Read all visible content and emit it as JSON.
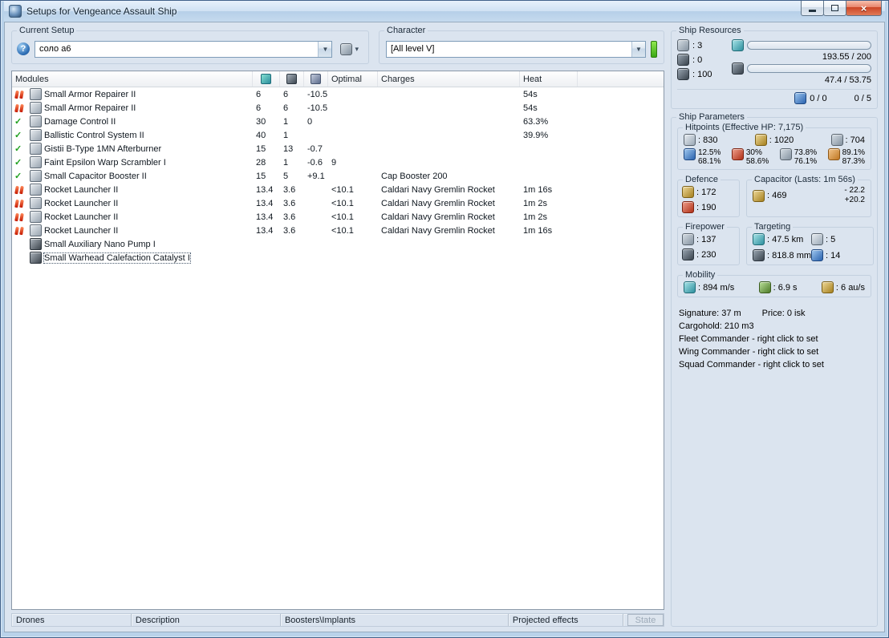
{
  "window": {
    "title": "Setups for Vengeance Assault Ship"
  },
  "setup": {
    "label": "Current Setup",
    "value": "соло а6"
  },
  "character": {
    "label": "Character",
    "value": "[All level V]"
  },
  "resources": {
    "label": "Ship Resources",
    "turrets": ": 3",
    "launchers": ": 0",
    "calibration": ": 100",
    "cpu": {
      "text": "193.55 / 200",
      "pct": 97
    },
    "powergrid": {
      "text": "47.4 / 53.75",
      "pct": 88
    },
    "drones": "0 / 0",
    "rigs": "0 / 5"
  },
  "modules": {
    "headers": {
      "name": "Modules",
      "optimal": "Optimal",
      "charges": "Charges",
      "heat": "Heat"
    },
    "rows": [
      {
        "state": "overload",
        "name": "Small Armor Repairer II",
        "cpu": "6",
        "pg": "6",
        "cap": "-10.5",
        "opt": "",
        "chg": "",
        "heat": "54s"
      },
      {
        "state": "overload",
        "name": "Small Armor Repairer II",
        "cpu": "6",
        "pg": "6",
        "cap": "-10.5",
        "opt": "",
        "chg": "",
        "heat": "54s"
      },
      {
        "state": "active",
        "name": "Damage Control II",
        "cpu": "30",
        "pg": "1",
        "cap": "0",
        "opt": "",
        "chg": "",
        "heat": "63.3%"
      },
      {
        "state": "active",
        "name": "Ballistic Control System II",
        "cpu": "40",
        "pg": "1",
        "cap": "",
        "opt": "",
        "chg": "",
        "heat": "39.9%"
      },
      {
        "state": "active",
        "name": "Gistii B-Type 1MN Afterburner",
        "cpu": "15",
        "pg": "13",
        "cap": "-0.7",
        "opt": "",
        "chg": "",
        "heat": ""
      },
      {
        "state": "active",
        "name": "Faint Epsilon Warp Scrambler I",
        "cpu": "28",
        "pg": "1",
        "cap": "-0.6",
        "opt": "9",
        "chg": "",
        "heat": ""
      },
      {
        "state": "active",
        "name": "Small Capacitor Booster II",
        "cpu": "15",
        "pg": "5",
        "cap": "+9.1",
        "opt": "",
        "chg": "Cap Booster 200",
        "heat": ""
      },
      {
        "state": "overload",
        "name": "Rocket Launcher II",
        "cpu": "13.4",
        "pg": "3.6",
        "cap": "",
        "opt": "<10.1",
        "chg": "Caldari Navy Gremlin Rocket",
        "heat": "1m 16s"
      },
      {
        "state": "overload",
        "name": "Rocket Launcher II",
        "cpu": "13.4",
        "pg": "3.6",
        "cap": "",
        "opt": "<10.1",
        "chg": "Caldari Navy Gremlin Rocket",
        "heat": "1m 2s"
      },
      {
        "state": "overload",
        "name": "Rocket Launcher II",
        "cpu": "13.4",
        "pg": "3.6",
        "cap": "",
        "opt": "<10.1",
        "chg": "Caldari Navy Gremlin Rocket",
        "heat": "1m 2s"
      },
      {
        "state": "overload",
        "name": "Rocket Launcher II",
        "cpu": "13.4",
        "pg": "3.6",
        "cap": "",
        "opt": "<10.1",
        "chg": "Caldari Navy Gremlin Rocket",
        "heat": "1m 16s"
      },
      {
        "state": "none",
        "name": "Small Auxiliary Nano Pump I",
        "rig": true,
        "cpu": "",
        "pg": "",
        "cap": "",
        "opt": "",
        "chg": "",
        "heat": ""
      },
      {
        "state": "none",
        "name": "Small Warhead Calefaction Catalyst I",
        "rig": true,
        "selected": true,
        "cpu": "",
        "pg": "",
        "cap": "",
        "opt": "",
        "chg": "",
        "heat": ""
      }
    ]
  },
  "params": {
    "label": "Ship Parameters",
    "hitpoints": {
      "label": "Hitpoints (Effective HP: 7,175)",
      "shield": ": 830",
      "armor": ": 1020",
      "hull": ": 704",
      "resists": [
        {
          "top": "12.5%",
          "bottom": "68.1%"
        },
        {
          "top": "30%",
          "bottom": "58.6%"
        },
        {
          "top": "73.8%",
          "bottom": "76.1%"
        },
        {
          "top": "89.1%",
          "bottom": "87.3%"
        }
      ]
    },
    "defence": {
      "label": "Defence",
      "v1": ": 172",
      "v2": ": 190"
    },
    "capacitor": {
      "label": "Capacitor (Lasts: 1m 56s)",
      "amount": ": 469",
      "out": "- 22.2",
      "in": "+20.2"
    },
    "firepower": {
      "label": "Firepower",
      "v1": ": 137",
      "v2": ": 230"
    },
    "targeting": {
      "label": "Targeting",
      "range": ": 47.5 km",
      "targets": ": 5",
      "scanres": ": 818.8 mm",
      "sensor": ": 14"
    },
    "mobility": {
      "label": "Mobility",
      "speed": ": 894 m/s",
      "align": ": 6.9 s",
      "warp": ": 6 au/s"
    },
    "signature": "Signature: 37 m",
    "price": "Price: 0 isk",
    "cargohold": "Cargohold: 210 m3",
    "fleet": "Fleet Commander - right click to set",
    "wing": "Wing Commander - right click to set",
    "squad": "Squad Commander - right click to set"
  },
  "tabs": [
    {
      "label": "Drones"
    },
    {
      "label": "Description"
    },
    {
      "label": "Boosters\\Implants"
    },
    {
      "label": "Projected effects"
    }
  ],
  "state_button": "State"
}
